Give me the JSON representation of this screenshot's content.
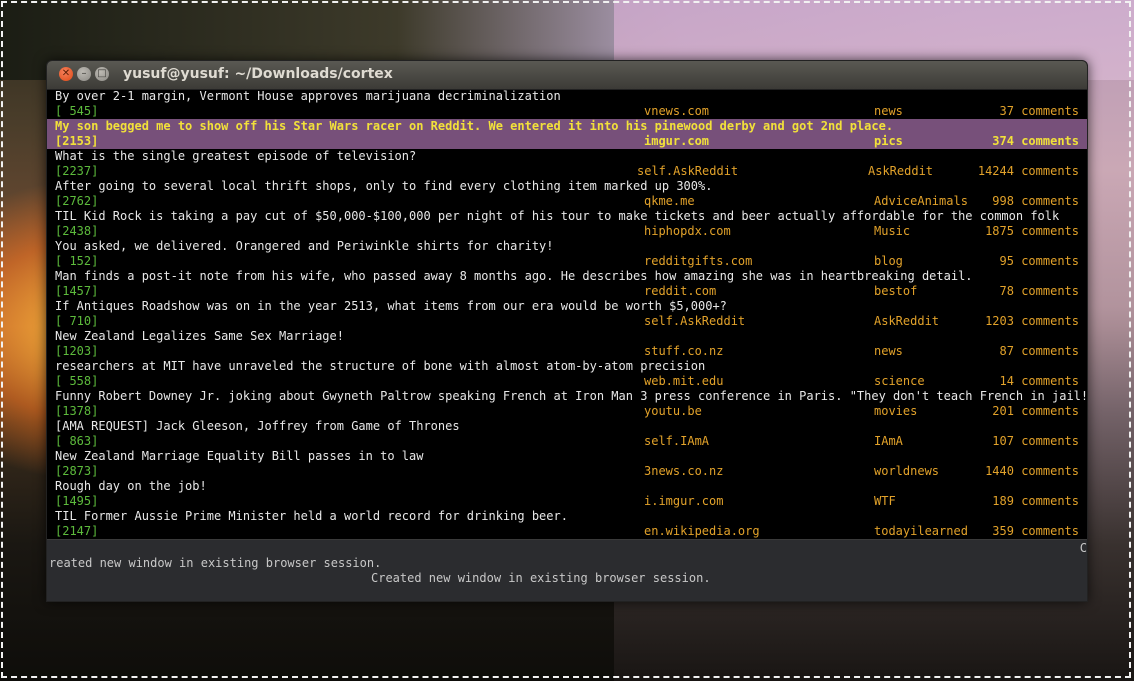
{
  "window": {
    "title": "yusuf@yusuf: ~/Downloads/cortex"
  },
  "colors": {
    "selected_bg": "#77507a",
    "selected_fg": "#f2e13a",
    "score": "#5dbb3c",
    "meta": "#e2a22a",
    "text": "#e8e8e8"
  },
  "entries": [
    {
      "title": "By over 2-1 margin, Vermont House approves marijuana decriminalization",
      "score": "[ 545]",
      "domain": "vnews.com",
      "subreddit": "news",
      "comments": "37 comments"
    },
    {
      "title": "My son begged me to show off his Star Wars racer on Reddit. We entered it into his pinewood derby and got 2nd place.",
      "score": "[2153]",
      "domain": "imgur.com",
      "subreddit": "pics",
      "comments": "374 comments",
      "selected": true
    },
    {
      "title": "What is the single greatest episode of television?",
      "score": "[2237]",
      "domain": "self.AskReddit",
      "subreddit": "AskReddit",
      "comments": "14244 comments"
    },
    {
      "title": "After going to several local thrift shops, only to find every clothing item marked up 300%.",
      "score": "[2762]",
      "domain": "qkme.me",
      "subreddit": "AdviceAnimals",
      "comments": "998 comments"
    },
    {
      "title": "TIL Kid Rock is taking a pay cut of $50,000-$100,000 per night of his tour to make tickets and beer actually affordable for the common folk",
      "score": "[2438]",
      "domain": "hiphopdx.com",
      "subreddit": "Music",
      "comments": "1875 comments"
    },
    {
      "title": "You asked, we delivered. Orangered and Periwinkle shirts for charity!",
      "score": "[ 152]",
      "domain": "redditgifts.com",
      "subreddit": "blog",
      "comments": "95 comments"
    },
    {
      "title": "Man finds a post-it note from his wife, who passed away 8 months ago. He describes how amazing she was in heartbreaking detail.",
      "score": "[1457]",
      "domain": "reddit.com",
      "subreddit": "bestof",
      "comments": "78 comments"
    },
    {
      "title": "If Antiques Roadshow was on in the year 2513, what items from our era would be worth $5,000+?",
      "score": "[ 710]",
      "domain": "self.AskReddit",
      "subreddit": "AskReddit",
      "comments": "1203 comments"
    },
    {
      "title": "New Zealand Legalizes Same Sex Marriage!",
      "score": "[1203]",
      "domain": "stuff.co.nz",
      "subreddit": "news",
      "comments": "87 comments"
    },
    {
      "title": "researchers at MIT have unraveled the structure of bone with almost atom-by-atom precision",
      "score": "[ 558]",
      "domain": "web.mit.edu",
      "subreddit": "science",
      "comments": "14 comments"
    },
    {
      "title": "Funny Robert Downey Jr. joking about Gwyneth Paltrow speaking French at Iron Man 3 press conference in Paris. \"They don't teach French in jail!\"",
      "score": "[1378]",
      "domain": "youtu.be",
      "subreddit": "movies",
      "comments": "201 comments"
    },
    {
      "title": "[AMA REQUEST] Jack Gleeson, Joffrey from Game of Thrones",
      "score": "[ 863]",
      "domain": "self.IAmA",
      "subreddit": "IAmA",
      "comments": "107 comments"
    },
    {
      "title": "New Zealand Marriage Equality Bill passes in to law",
      "score": "[2873]",
      "domain": "3news.co.nz",
      "subreddit": "worldnews",
      "comments": "1440 comments"
    },
    {
      "title": "Rough day on the job!",
      "score": "[1495]",
      "domain": "i.imgur.com",
      "subreddit": "WTF",
      "comments": "189 comments"
    },
    {
      "title": "TIL Former Aussie Prime Minister held a world record for drinking beer.",
      "score": "[2147]",
      "domain": "en.wikipedia.org",
      "subreddit": "todayilearned",
      "comments": "359 comments"
    }
  ],
  "status": {
    "corner": "C",
    "line1": "reated new window in existing browser session.",
    "line2": "Created new window in existing browser session."
  }
}
